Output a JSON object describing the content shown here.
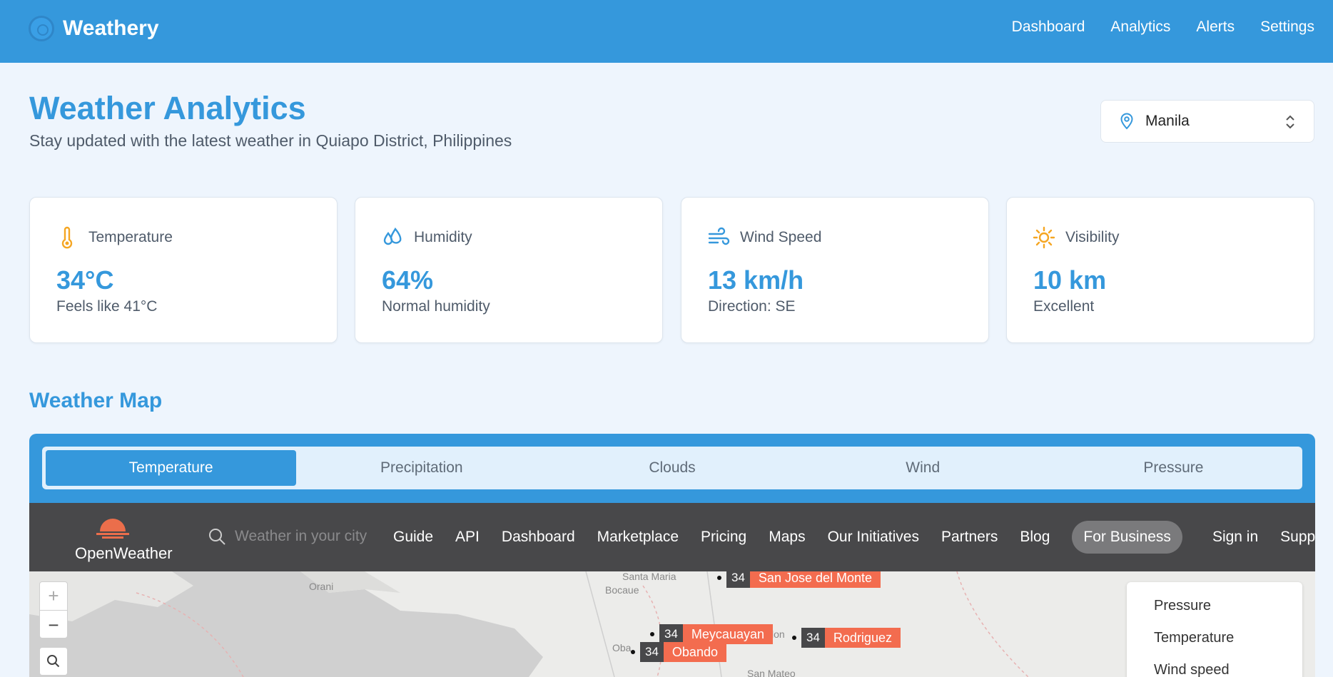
{
  "app": {
    "name": "Weathery"
  },
  "nav": {
    "items": [
      "Dashboard",
      "Analytics",
      "Alerts",
      "Settings"
    ]
  },
  "header": {
    "title": "Weather Analytics",
    "subtitle": "Stay updated with the latest weather in Quiapo District, Philippines",
    "location": "Manila"
  },
  "cards": [
    {
      "label": "Temperature",
      "value": "34°C",
      "note": "Feels like 41°C",
      "icon": "thermometer-icon"
    },
    {
      "label": "Humidity",
      "value": "64%",
      "note": "Normal humidity",
      "icon": "droplets-icon"
    },
    {
      "label": "Wind Speed",
      "value": "13 km/h",
      "note": "Direction: SE",
      "icon": "wind-icon"
    },
    {
      "label": "Visibility",
      "value": "10 km",
      "note": "Excellent",
      "icon": "sun-icon"
    }
  ],
  "map": {
    "title": "Weather Map",
    "tabs": [
      "Temperature",
      "Precipitation",
      "Clouds",
      "Wind",
      "Pressure"
    ],
    "active_tab": "Temperature"
  },
  "openweather": {
    "logo_text": "OpenWeather",
    "search_placeholder": "Weather in your city",
    "nav": [
      "Guide",
      "API",
      "Dashboard",
      "Marketplace",
      "Pricing",
      "Maps",
      "Our Initiatives",
      "Partners",
      "Blog",
      "For Business",
      "Sign in",
      "Support"
    ],
    "zoom_in": "+",
    "zoom_out": "−",
    "cities": [
      {
        "temp": "34",
        "name": "San Jose del Monte"
      },
      {
        "temp": "34",
        "name": "Meycauayan"
      },
      {
        "temp": "34",
        "name": "Rodriguez"
      },
      {
        "temp": "34",
        "name": "Obando"
      }
    ],
    "place_labels": [
      "Santa Maria",
      "Orani",
      "Bocaue",
      "San Mateo",
      "Oba",
      "lon"
    ],
    "layers": [
      "Pressure",
      "Temperature",
      "Wind speed"
    ]
  },
  "colors": {
    "primary": "#3598dc",
    "accent": "#f36c4f",
    "ow_bar": "#48484a"
  }
}
